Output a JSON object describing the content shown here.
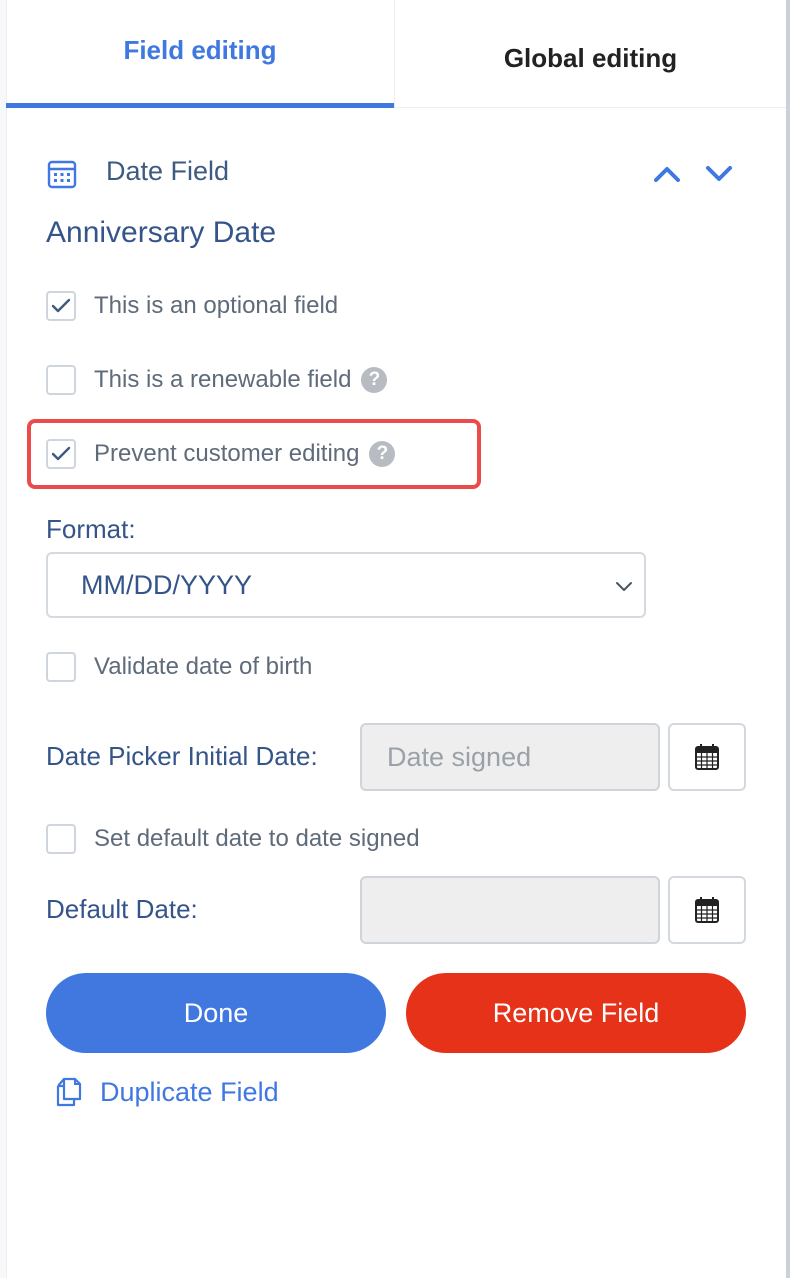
{
  "tabs": {
    "field_editing": "Field editing",
    "global_editing": "Global editing",
    "active": "field_editing"
  },
  "field": {
    "type_label": "Date Field",
    "type_icon": "calendar-icon",
    "name": "Anniversary Date"
  },
  "options": {
    "optional": {
      "label": "This is an optional field",
      "checked": true
    },
    "renewable": {
      "label": "This is a renewable field",
      "checked": false,
      "help": "?"
    },
    "prevent_editing": {
      "label": "Prevent customer editing",
      "checked": true,
      "help": "?"
    },
    "validate_dob": {
      "label": "Validate date of birth",
      "checked": false
    },
    "default_to_signed": {
      "label": "Set default date to date signed",
      "checked": false
    }
  },
  "format": {
    "label": "Format:",
    "selected": "MM/DD/YYYY"
  },
  "date_picker": {
    "label": "Date Picker Initial Date:",
    "placeholder": "Date signed"
  },
  "default_date": {
    "label": "Default Date:",
    "value": ""
  },
  "actions": {
    "done": "Done",
    "remove": "Remove Field",
    "duplicate": "Duplicate Field"
  },
  "colors": {
    "accent": "#3f78e0",
    "danger": "#e63218",
    "highlight": "#ec4b4b",
    "text": "#35558a"
  }
}
